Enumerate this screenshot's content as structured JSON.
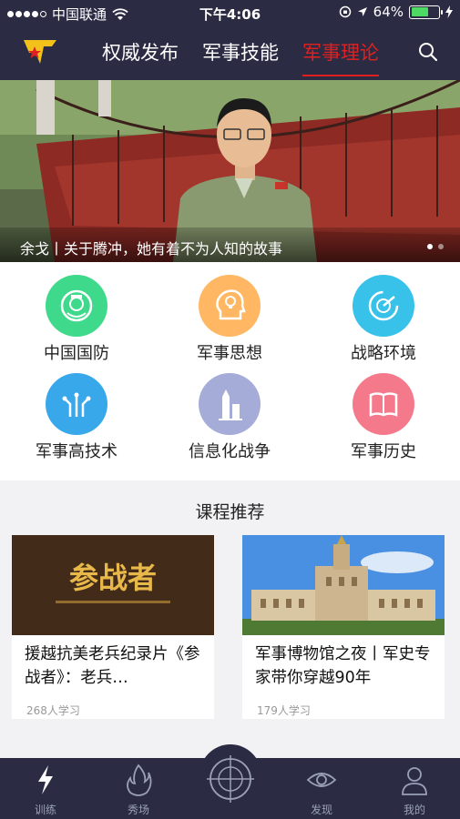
{
  "status": {
    "carrier": "中国联通",
    "time": "下午4:06",
    "battery_percent": "64%",
    "battery_level": 0.64
  },
  "header": {
    "tabs": [
      {
        "label": "权威发布",
        "active": false
      },
      {
        "label": "军事技能",
        "active": false
      },
      {
        "label": "军事理论",
        "active": true
      }
    ]
  },
  "banner": {
    "caption": "余戈丨关于腾冲，她有着不为人知的故事",
    "pages": 2,
    "active_page": 1
  },
  "categories": [
    {
      "label": "中国国防",
      "color": "#3ed98b",
      "icon": "national-emblem-icon"
    },
    {
      "label": "军事思想",
      "color": "#ffb764",
      "icon": "head-lightbulb-icon"
    },
    {
      "label": "战略环境",
      "color": "#38c2ea",
      "icon": "radar-icon"
    },
    {
      "label": "军事高技术",
      "color": "#38a8ea",
      "icon": "circuit-icon"
    },
    {
      "label": "信息化战争",
      "color": "#a5acd8",
      "icon": "missile-icon"
    },
    {
      "label": "军事历史",
      "color": "#f47a8b",
      "icon": "book-icon"
    }
  ],
  "recommend": {
    "title": "课程推荐",
    "cards": [
      {
        "title": "援越抗美老兵纪录片《参战者》：老兵…",
        "learners": "268人学习",
        "thumb_text": "参战者"
      },
      {
        "title": "军事博物馆之夜丨军史专家带你穿越90年",
        "learners": "179人学习"
      }
    ]
  },
  "tabbar": {
    "items": [
      {
        "label": "训练",
        "icon": "lightning-icon"
      },
      {
        "label": "秀场",
        "icon": "flame-icon"
      },
      {
        "label": "发现",
        "icon": "eye-icon"
      },
      {
        "label": "我的",
        "icon": "user-icon"
      }
    ],
    "center_icon": "crosshair-icon"
  },
  "colors": {
    "navy": "#2b2c43",
    "accent_red": "#e02020"
  }
}
